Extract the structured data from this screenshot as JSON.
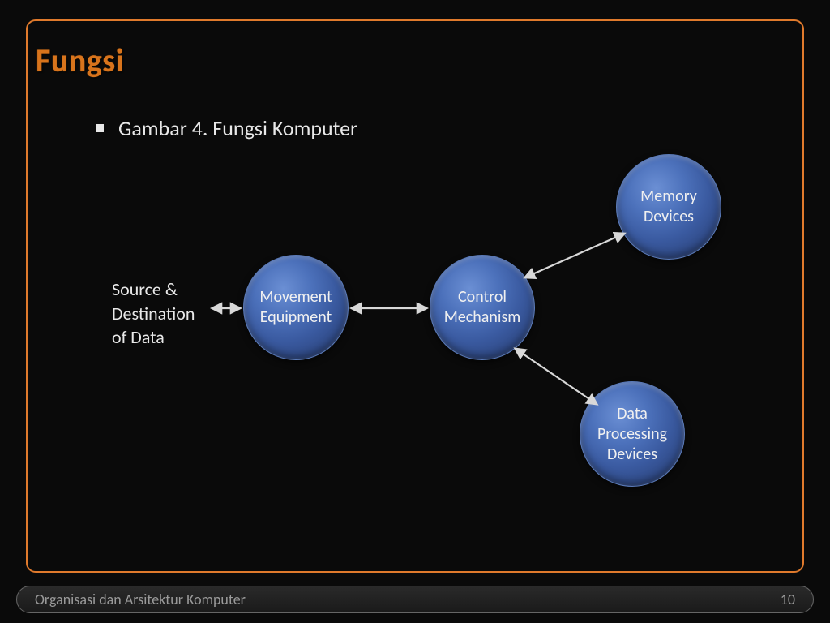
{
  "slide": {
    "title": "Fungsi",
    "bullet": "Gambar 4. Fungsi Komputer"
  },
  "diagram": {
    "source_label": "Source &\nDestination\nof Data",
    "nodes": {
      "movement": "Movement\nEquipment",
      "control": "Control\nMechanism",
      "memory": "Memory\nDevices",
      "processing": "Data\nProcessing\nDevices"
    }
  },
  "footer": {
    "text": "Organisasi dan Arsitektur Komputer",
    "page": "10"
  }
}
